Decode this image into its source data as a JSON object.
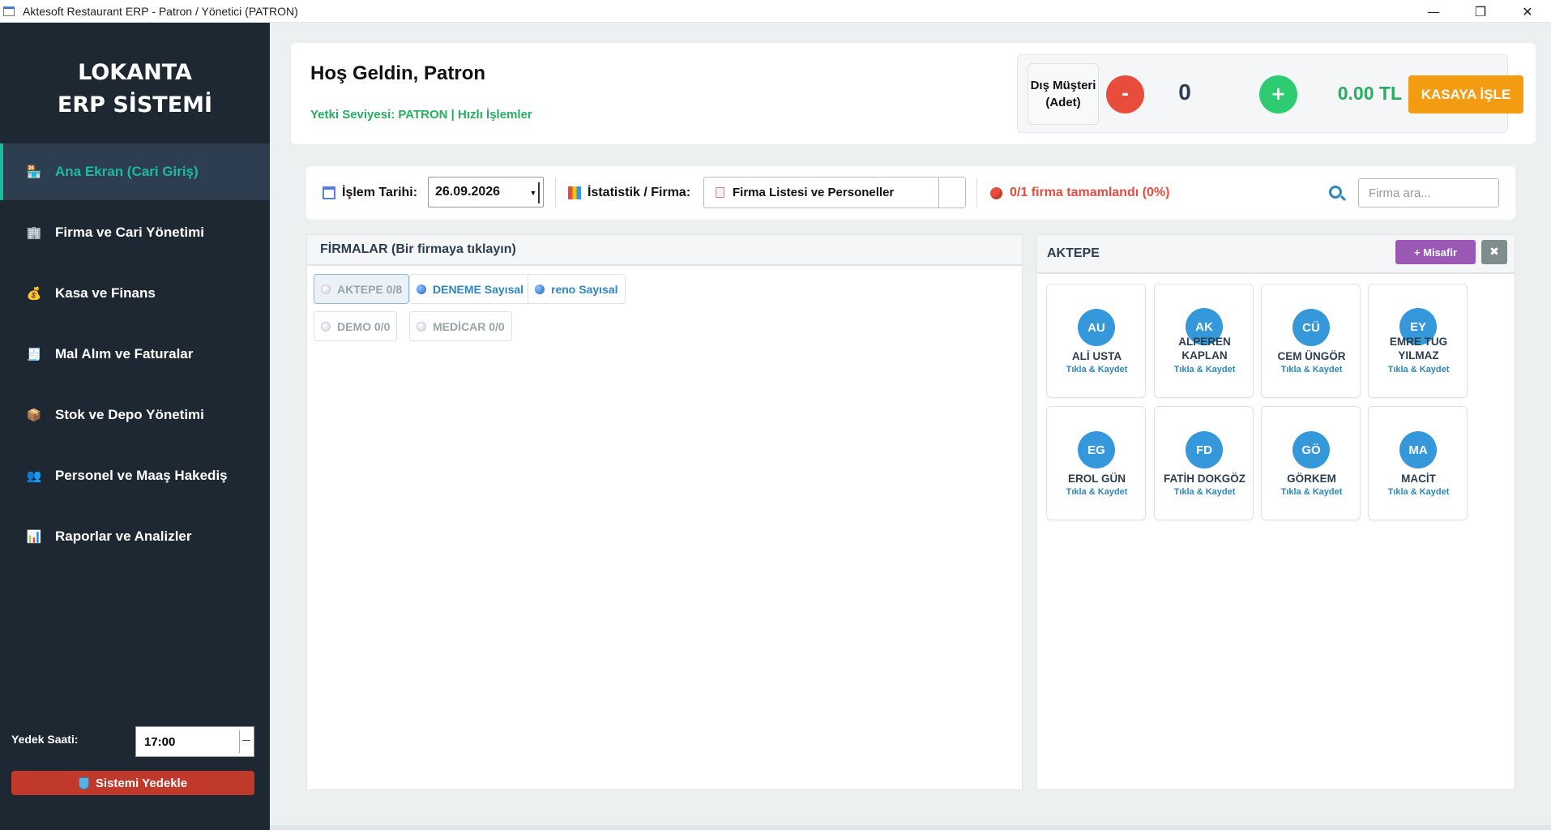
{
  "window": {
    "title": "Aktesoft Restaurant ERP - Patron / Yönetici (PATRON)",
    "controls": {
      "minimize": "—",
      "maximize": "❐",
      "close": "✕"
    }
  },
  "sidebar": {
    "brand_line1": "LOKANTA",
    "brand_line2": "ERP SİSTEMİ",
    "items": [
      {
        "label": "Ana Ekran (Cari Giriş)",
        "icon": "store-icon",
        "glyph": "🏪",
        "active": true
      },
      {
        "label": "Firma ve Cari Yönetimi",
        "icon": "building-icon",
        "glyph": "🏢",
        "active": false
      },
      {
        "label": "Kasa ve Finans",
        "icon": "money-bag-icon",
        "glyph": "💰",
        "active": false
      },
      {
        "label": "Mal Alım ve Faturalar",
        "icon": "receipt-icon",
        "glyph": "🧾",
        "active": false
      },
      {
        "label": "Stok ve Depo Yönetimi",
        "icon": "package-icon",
        "glyph": "📦",
        "active": false
      },
      {
        "label": "Personel ve Maaş Hakediş",
        "icon": "people-icon",
        "glyph": "👥",
        "active": false
      },
      {
        "label": "Raporlar ve Analizler",
        "icon": "bar-chart-icon",
        "glyph": "📊",
        "active": false
      }
    ],
    "backup_label": "Yedek Saati:",
    "backup_time": "17:00",
    "backup_button": "Sistemi Yedekle"
  },
  "header": {
    "welcome": "Hoş Geldin, Patron",
    "authority": "Yetki Seviyesi: PATRON | Hızlı İşlemler",
    "external_customer_line1": "Dış Müşteri",
    "external_customer_line2": "(Adet)",
    "minus_label": "-",
    "count": "0",
    "plus_label": "+",
    "amount": "0.00 TL",
    "cashier_button": "KASAYA İŞLE"
  },
  "filters": {
    "date_label": "İşlem Tarihi:",
    "date_value": "26.09.2026",
    "stats_label": "İstatistik / Firma:",
    "firm_select": "Firma Listesi ve Personeller",
    "status": "0/1 firma tamamlandı (0%)",
    "search_placeholder": "Firma ara..."
  },
  "firms": {
    "header": "FİRMALAR (Bir firmaya tıklayın)",
    "chips": [
      {
        "label": "AKTEPE 0/8",
        "style": "selected"
      },
      {
        "label": "DENEME Sayısal",
        "style": "blue"
      },
      {
        "label": "reno Sayısal",
        "style": "blue"
      },
      {
        "label": "DEMO 0/0",
        "style": "muted"
      },
      {
        "label": "MEDİCAR 0/0",
        "style": "muted"
      }
    ]
  },
  "staff": {
    "title": "AKTEPE",
    "guest_button": "+ Misafir",
    "close_button": "✖",
    "cards": [
      {
        "initials": "AU",
        "name": "ALİ USTA",
        "action": "Tıkla & Kaydet"
      },
      {
        "initials": "AK",
        "name": "ALPEREN KAPLAN",
        "action": "Tıkla & Kaydet"
      },
      {
        "initials": "CÜ",
        "name": "CEM ÜNGÖR",
        "action": "Tıkla & Kaydet"
      },
      {
        "initials": "EY",
        "name": "EMRE TUG YILMAZ",
        "action": "Tıkla & Kaydet"
      },
      {
        "initials": "EG",
        "name": "EROL GÜN",
        "action": "Tıkla & Kaydet"
      },
      {
        "initials": "FD",
        "name": "FATİH DOKGÖZ",
        "action": "Tıkla & Kaydet"
      },
      {
        "initials": "GÖ",
        "name": "GÖRKEM",
        "action": "Tıkla & Kaydet"
      },
      {
        "initials": "MA",
        "name": "MACİT",
        "action": "Tıkla & Kaydet"
      }
    ]
  },
  "colors": {
    "sidebar": "#1e2832",
    "accent": "#1abc9c",
    "success": "#27ae60",
    "danger": "#e74c3c",
    "warning": "#f39c12",
    "purple": "#9b59b6",
    "avatar": "#3498db"
  }
}
